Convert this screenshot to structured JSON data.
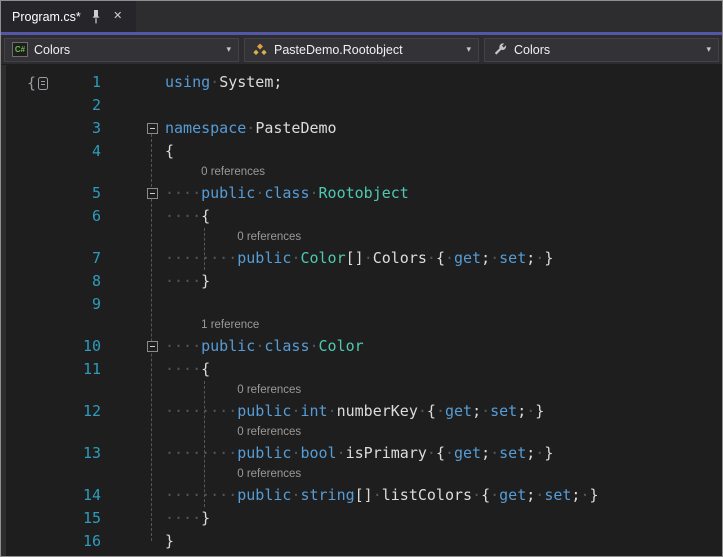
{
  "tab_bar": {
    "tab_title": "Program.cs*",
    "close_glyph": "✕"
  },
  "nav_bar": {
    "chevron_glyph": "▾",
    "dropdowns": [
      {
        "icon": "csharp-project-icon",
        "label": "Colors"
      },
      {
        "icon": "class-icon",
        "label": "PasteDemo.Rootobject"
      },
      {
        "icon": "property-wrench-icon",
        "label": "Colors"
      }
    ]
  },
  "colors": {
    "editor_background": "#1e1e1e",
    "chrome_background": "#2d2d30",
    "accent_underline": "#5456a8",
    "keyword": "#569cd6",
    "type_name": "#4ec9b0",
    "text": "#dcdcdc",
    "line_number": "#2e9cbe",
    "codelens": "#9a9a9a",
    "whitespace_dot": "#4d585e"
  },
  "editor": {
    "rows": [
      {
        "kind": "code",
        "num": "1",
        "segs": [
          [
            "kw",
            "using"
          ],
          [
            "ws",
            "·"
          ],
          [
            "plain",
            "System;"
          ]
        ]
      },
      {
        "kind": "code",
        "num": "2",
        "segs": []
      },
      {
        "kind": "code",
        "num": "3",
        "fold": true,
        "segs": [
          [
            "kw",
            "namespace"
          ],
          [
            "ws",
            "·"
          ],
          [
            "plain",
            "PasteDemo"
          ]
        ]
      },
      {
        "kind": "code",
        "num": "4",
        "segs": [
          [
            "plain",
            "{"
          ]
        ]
      },
      {
        "kind": "lens",
        "indent": 4,
        "text": "0 references"
      },
      {
        "kind": "code",
        "num": "5",
        "fold": true,
        "segs": [
          [
            "ws",
            "····"
          ],
          [
            "kw",
            "public"
          ],
          [
            "ws",
            "·"
          ],
          [
            "kw",
            "class"
          ],
          [
            "ws",
            "·"
          ],
          [
            "type",
            "Rootobject"
          ]
        ]
      },
      {
        "kind": "code",
        "num": "6",
        "segs": [
          [
            "ws",
            "····"
          ],
          [
            "plain",
            "{"
          ]
        ]
      },
      {
        "kind": "lens",
        "indent": 8,
        "text": "0 references"
      },
      {
        "kind": "code",
        "num": "7",
        "segs": [
          [
            "ws",
            "········"
          ],
          [
            "kw",
            "public"
          ],
          [
            "ws",
            "·"
          ],
          [
            "type",
            "Color"
          ],
          [
            "plain",
            "[]"
          ],
          [
            "ws",
            "·"
          ],
          [
            "plain",
            "Colors"
          ],
          [
            "ws",
            "·"
          ],
          [
            "plain",
            "{"
          ],
          [
            "ws",
            "·"
          ],
          [
            "kw",
            "get"
          ],
          [
            "plain",
            ";"
          ],
          [
            "ws",
            "·"
          ],
          [
            "kw",
            "set"
          ],
          [
            "plain",
            ";"
          ],
          [
            "ws",
            "·"
          ],
          [
            "plain",
            "}"
          ]
        ]
      },
      {
        "kind": "code",
        "num": "8",
        "segs": [
          [
            "ws",
            "····"
          ],
          [
            "plain",
            "}"
          ]
        ]
      },
      {
        "kind": "code",
        "num": "9",
        "segs": []
      },
      {
        "kind": "lens",
        "indent": 4,
        "text": "1 reference"
      },
      {
        "kind": "code",
        "num": "10",
        "fold": true,
        "segs": [
          [
            "ws",
            "····"
          ],
          [
            "kw",
            "public"
          ],
          [
            "ws",
            "·"
          ],
          [
            "kw",
            "class"
          ],
          [
            "ws",
            "·"
          ],
          [
            "type",
            "Color"
          ]
        ]
      },
      {
        "kind": "code",
        "num": "11",
        "segs": [
          [
            "ws",
            "····"
          ],
          [
            "plain",
            "{"
          ]
        ]
      },
      {
        "kind": "lens",
        "indent": 8,
        "text": "0 references"
      },
      {
        "kind": "code",
        "num": "12",
        "segs": [
          [
            "ws",
            "········"
          ],
          [
            "kw",
            "public"
          ],
          [
            "ws",
            "·"
          ],
          [
            "kw",
            "int"
          ],
          [
            "ws",
            "·"
          ],
          [
            "plain",
            "numberKey"
          ],
          [
            "ws",
            "·"
          ],
          [
            "plain",
            "{"
          ],
          [
            "ws",
            "·"
          ],
          [
            "kw",
            "get"
          ],
          [
            "plain",
            ";"
          ],
          [
            "ws",
            "·"
          ],
          [
            "kw",
            "set"
          ],
          [
            "plain",
            ";"
          ],
          [
            "ws",
            "·"
          ],
          [
            "plain",
            "}"
          ]
        ]
      },
      {
        "kind": "lens",
        "indent": 8,
        "text": "0 references"
      },
      {
        "kind": "code",
        "num": "13",
        "segs": [
          [
            "ws",
            "········"
          ],
          [
            "kw",
            "public"
          ],
          [
            "ws",
            "·"
          ],
          [
            "kw",
            "bool"
          ],
          [
            "ws",
            "·"
          ],
          [
            "plain",
            "isPrimary"
          ],
          [
            "ws",
            "·"
          ],
          [
            "plain",
            "{"
          ],
          [
            "ws",
            "·"
          ],
          [
            "kw",
            "get"
          ],
          [
            "plain",
            ";"
          ],
          [
            "ws",
            "·"
          ],
          [
            "kw",
            "set"
          ],
          [
            "plain",
            ";"
          ],
          [
            "ws",
            "·"
          ],
          [
            "plain",
            "}"
          ]
        ]
      },
      {
        "kind": "lens",
        "indent": 8,
        "text": "0 references"
      },
      {
        "kind": "code",
        "num": "14",
        "segs": [
          [
            "ws",
            "········"
          ],
          [
            "kw",
            "public"
          ],
          [
            "ws",
            "·"
          ],
          [
            "kw",
            "string"
          ],
          [
            "plain",
            "[]"
          ],
          [
            "ws",
            "·"
          ],
          [
            "plain",
            "listColors"
          ],
          [
            "ws",
            "·"
          ],
          [
            "plain",
            "{"
          ],
          [
            "ws",
            "·"
          ],
          [
            "kw",
            "get"
          ],
          [
            "plain",
            ";"
          ],
          [
            "ws",
            "·"
          ],
          [
            "kw",
            "set"
          ],
          [
            "plain",
            ";"
          ],
          [
            "ws",
            "·"
          ],
          [
            "plain",
            "}"
          ]
        ]
      },
      {
        "kind": "code",
        "num": "15",
        "segs": [
          [
            "ws",
            "····"
          ],
          [
            "plain",
            "}"
          ]
        ]
      },
      {
        "kind": "code",
        "num": "16",
        "segs": [
          [
            "plain",
            "}"
          ]
        ]
      }
    ]
  }
}
